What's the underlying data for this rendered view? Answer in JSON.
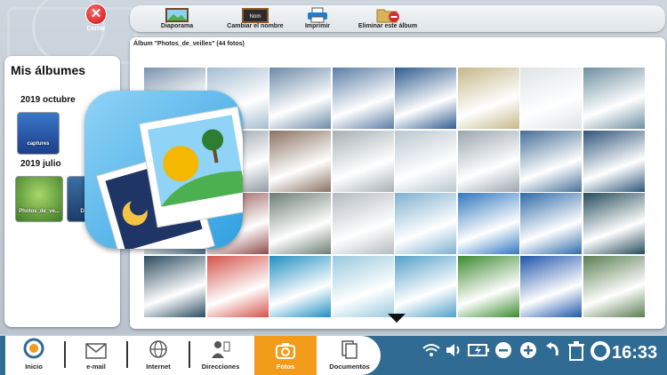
{
  "close": {
    "label": "Cerrar"
  },
  "toolbar": {
    "slideshow": "Diaporama",
    "rename": "Cambiar el nombre",
    "rename_sign": "Nom",
    "print": "Imprimir",
    "delete_album": "Eliminar este álbum"
  },
  "sidebar": {
    "title": "Mis álbumes",
    "groups": [
      {
        "year": "2019 octubre",
        "albums": [
          {
            "name": "captures"
          }
        ]
      },
      {
        "year": "2019 julio",
        "albums": [
          {
            "name": "Photos_de_ve..."
          },
          {
            "name": "Doc"
          }
        ]
      }
    ]
  },
  "album": {
    "title": "Álbum \"Photos_de_veilles\" (44 fotos)",
    "photo_colors": [
      [
        "#7b94ad",
        "#a4bdd2",
        "#6c8aa7",
        "#5b7da5",
        "#2f5c8f",
        "#c6b78a",
        "#dfe3e6",
        "#6f8fa1"
      ],
      [
        "#3d4f5f",
        "#8e9aa3",
        "#8a7262",
        "#a7b0b3",
        "#b8c7cf",
        "#9aa6ad",
        "#466f98",
        "#2f557b"
      ],
      [
        "#4b6f86",
        "#8e4b4a",
        "#6d7d73",
        "#b4bac0",
        "#7fb0cf",
        "#2f77c0",
        "#2e6aa8",
        "#254a5a"
      ],
      [
        "#2b4b5f",
        "#d4524a",
        "#1f8fc2",
        "#98c9dd",
        "#52a0c8",
        "#3c8a2e",
        "#1f55aa",
        "#5b7d52"
      ]
    ]
  },
  "dock": {
    "items": [
      {
        "label": "Inicio"
      },
      {
        "label": "e-mail"
      },
      {
        "label": "Internet"
      },
      {
        "label": "Direcciones"
      },
      {
        "label": "Fotos"
      },
      {
        "label": "Documentos"
      }
    ]
  },
  "status": {
    "time": "16:33"
  },
  "colors": {
    "accent": "#f39c1b",
    "bottom_bar": "#2f6b92"
  }
}
